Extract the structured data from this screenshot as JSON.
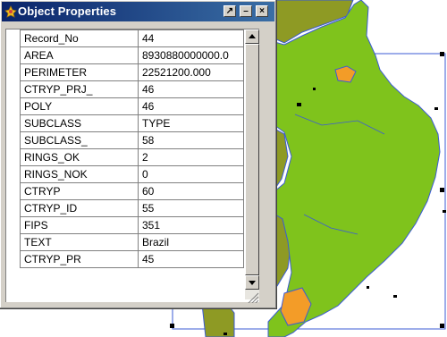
{
  "window": {
    "title": "Object Properties",
    "buttons": [
      "pin-icon",
      "minimize-icon",
      "close-icon"
    ]
  },
  "properties": [
    {
      "name": "Record_No",
      "value": "44"
    },
    {
      "name": "AREA",
      "value": "8930880000000.0"
    },
    {
      "name": "PERIMETER",
      "value": "22521200.000"
    },
    {
      "name": "CTRYP_PRJ_",
      "value": "46"
    },
    {
      "name": "POLY",
      "value": "46"
    },
    {
      "name": "SUBCLASS",
      "value": "TYPE"
    },
    {
      "name": "SUBCLASS_",
      "value": "58"
    },
    {
      "name": "RINGS_OK",
      "value": "2"
    },
    {
      "name": "RINGS_NOK",
      "value": "0"
    },
    {
      "name": "CTRYP",
      "value": "60"
    },
    {
      "name": "CTRYP_ID",
      "value": "55"
    },
    {
      "name": "FIPS",
      "value": "351"
    },
    {
      "name": "TEXT",
      "value": "Brazil"
    },
    {
      "name": "CTRYP_PR",
      "value": "45"
    }
  ],
  "map": {
    "selected_country_color": "#7fc31c",
    "neighbor_color": "#8e9a24",
    "highlight_color": "#f39c28",
    "border_color": "#3b5bd6"
  }
}
